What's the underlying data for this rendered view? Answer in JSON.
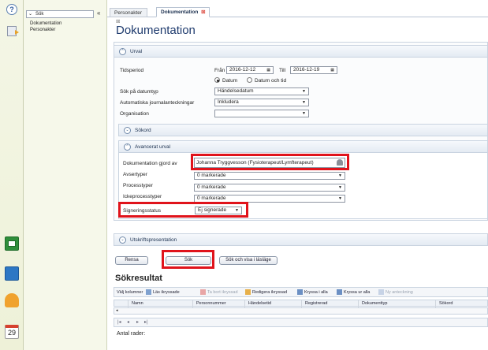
{
  "nav": {
    "search_label": "Sök",
    "items": [
      "Dokumentation",
      "Personakter"
    ]
  },
  "sidebar": {
    "calendar_day": "29"
  },
  "tabs": [
    {
      "label": "Personakter",
      "active": false
    },
    {
      "label": "Dokumentation",
      "active": true
    }
  ],
  "page": {
    "title": "Dokumentation"
  },
  "urval": {
    "header": "Urval",
    "tidsperiod_label": "Tidsperiod",
    "from_label": "Från",
    "from_value": "2016-12-12",
    "to_label": "Till",
    "to_value": "2016-12-19",
    "radio_datum": "Datum",
    "radio_datum_tid": "Datum och tid",
    "sok_datumtyp_label": "Sök på datumtyp",
    "sok_datumtyp_value": "Händelsedatum",
    "auto_label": "Automatiska journalanteckningar",
    "auto_value": "Inkludera",
    "org_label": "Organisation",
    "org_value": ""
  },
  "sokord": {
    "header": "Sökord"
  },
  "avancerat": {
    "header": "Avancerat urval",
    "gjord_av_label": "Dokumentation gjord av",
    "gjord_av_value": "Johanna Tryggvesson (Fysioterapeut/Lymfterapeut)",
    "avsertyper_label": "Avsertyper",
    "avsertyper_value": "0 markerade",
    "processtyper_label": "Processtyper",
    "processtyper_value": "0 markerade",
    "ickeprocesstyper_label": "Ickeprocesstyper",
    "ickeprocesstyper_value": "0 markerade",
    "signering_label": "Signeringsstatus",
    "signering_value": "Ej signerade"
  },
  "utskrift": {
    "header": "Utskriftspresentation"
  },
  "actions": {
    "rensa": "Rensa",
    "sok": "Sök",
    "sok_visa": "Sök och visa i läsläge"
  },
  "results": {
    "title": "Sökresultat",
    "toolbar": [
      "Välj kolumner",
      "Läs ikryssade",
      "Ta bort ikryssad",
      "Redigera ikryssad",
      "Kryssa i alla",
      "Kryssa ur alla",
      "Ny anteckning"
    ],
    "columns": [
      "Namn",
      "Personnummer",
      "Händelsetid",
      "Registrerad",
      "Dokumenttyp",
      "Sökord"
    ],
    "count_label": "Antal rader:"
  },
  "colors": {
    "highlight": "#e0131b",
    "title": "#1f3b6e"
  }
}
